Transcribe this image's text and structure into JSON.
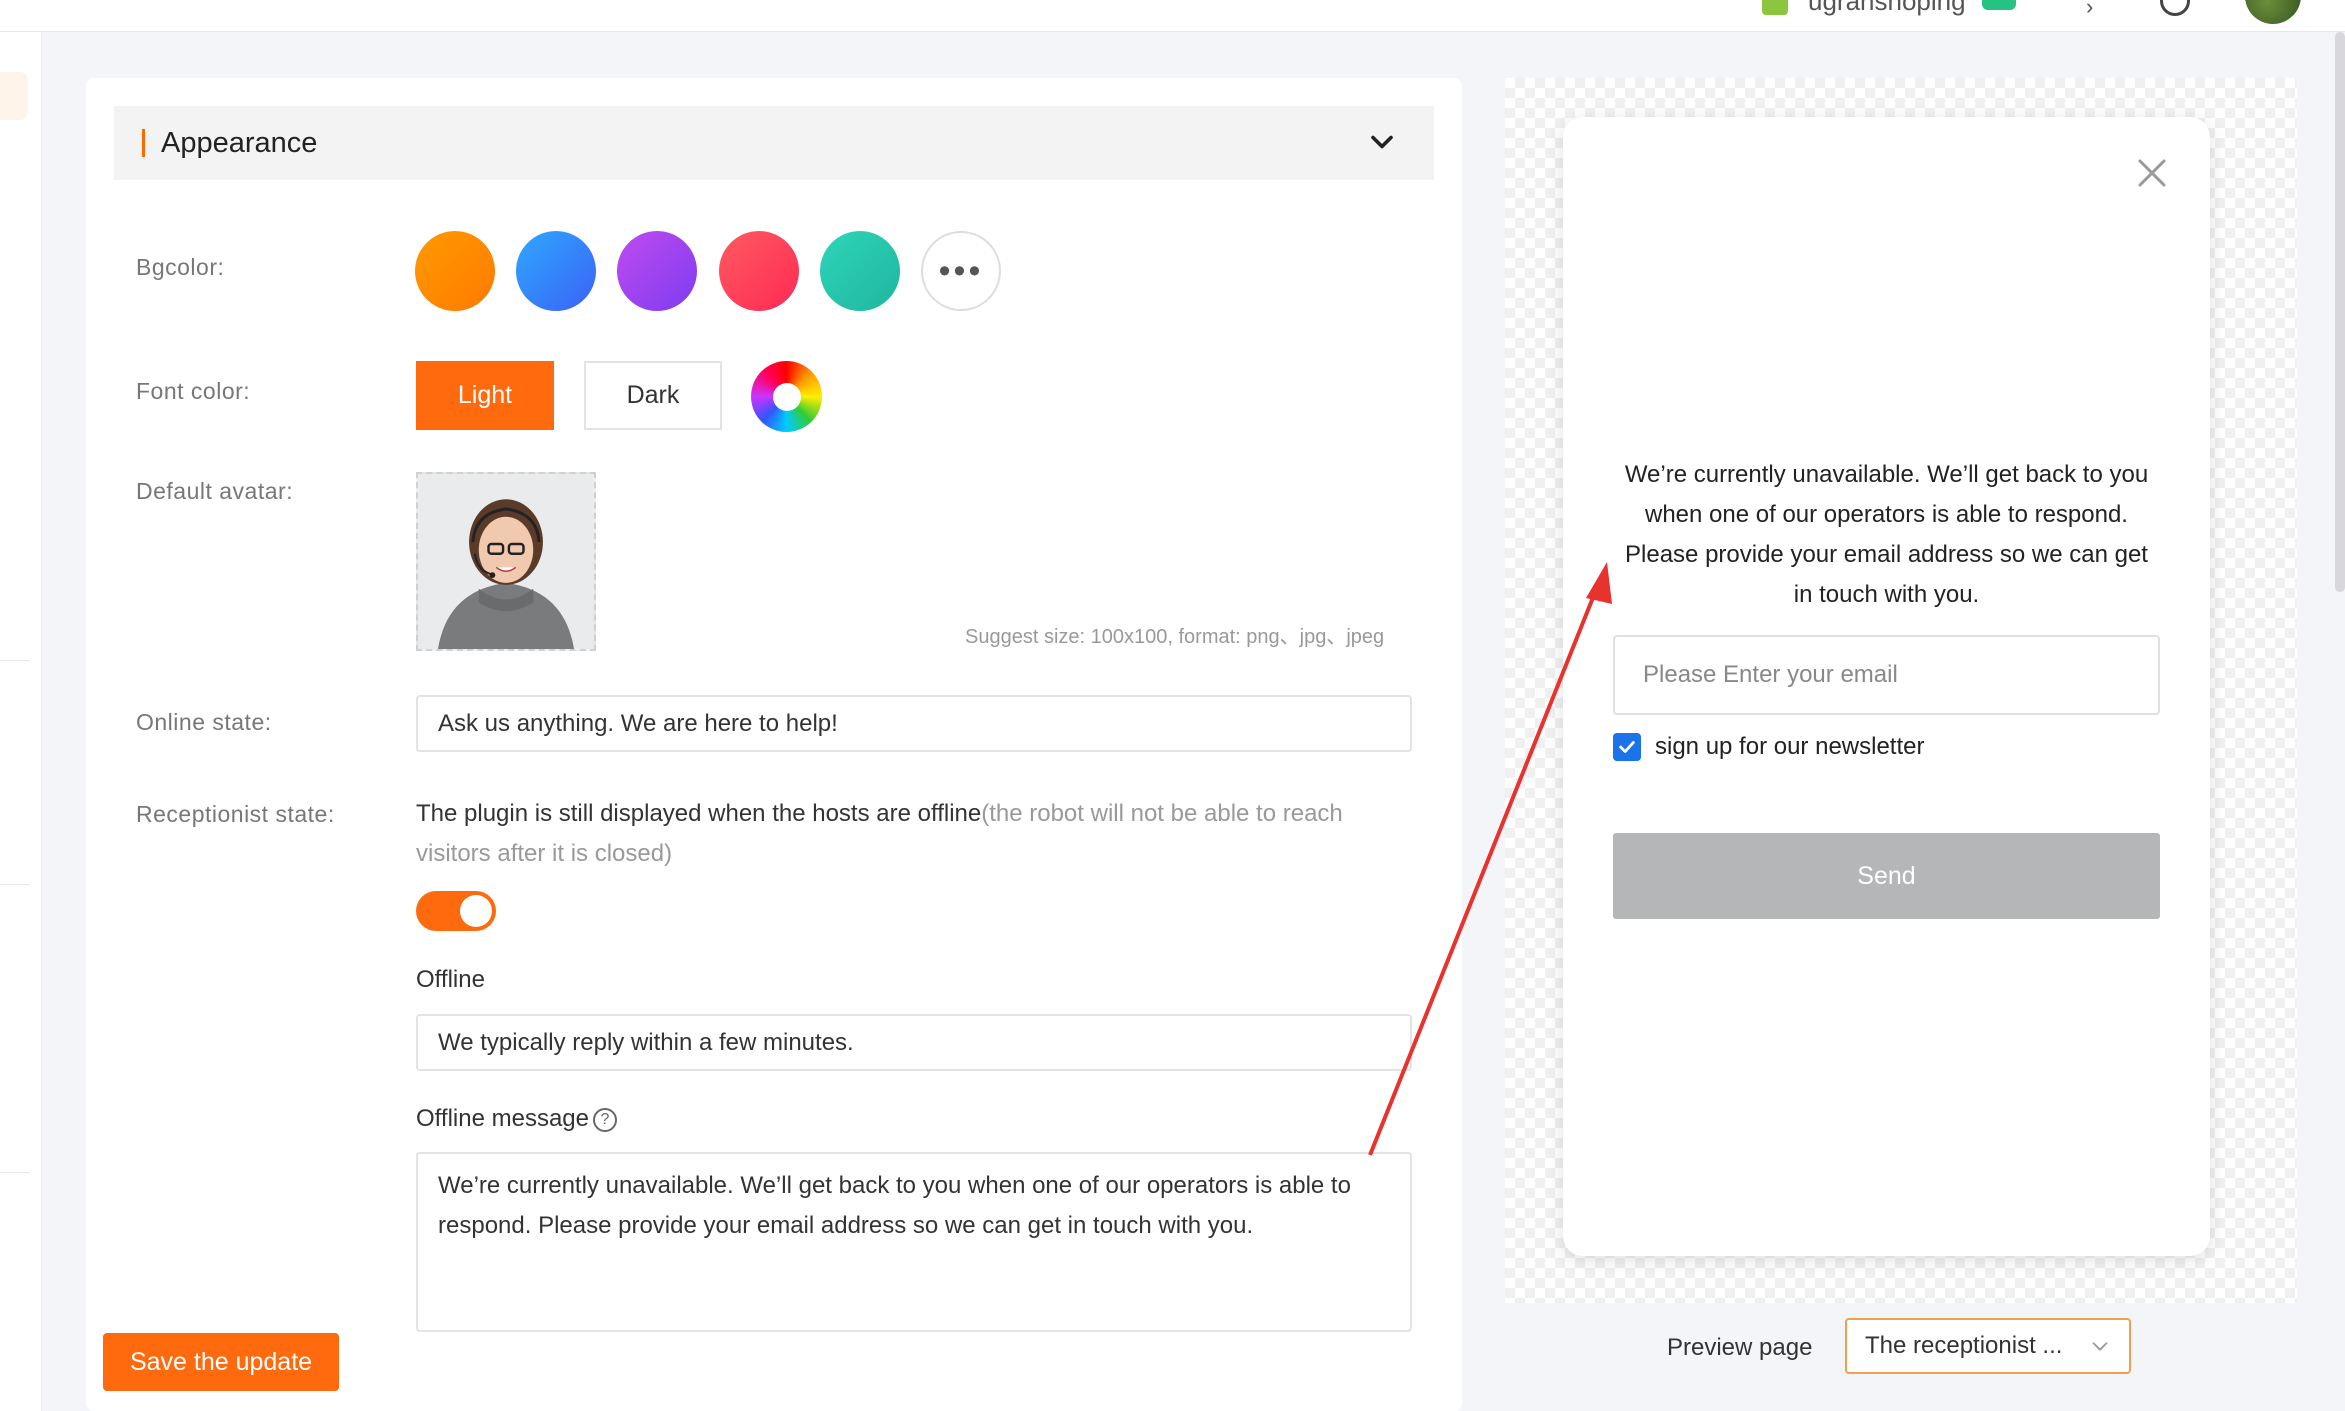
{
  "topbar": {
    "store_name": "ugrahshoping",
    "icons": [
      "store-icon",
      "chat-icon",
      "caret-icon",
      "info-icon",
      "user-avatar"
    ]
  },
  "section": {
    "title": "Appearance"
  },
  "labels": {
    "bgcolor": "Bgcolor:",
    "font_color": "Font color:",
    "default_avatar": "Default avatar:",
    "online_state": "Online state:",
    "receptionist_state": "Receptionist state:"
  },
  "bgcolor": {
    "swatches": [
      "#FF8A00",
      "#3B7BF6",
      "#9D45F0",
      "#FF3F5A",
      "#24C7AE"
    ],
    "more_label": "•••"
  },
  "font_color": {
    "light": "Light",
    "dark": "Dark",
    "selected": "Light"
  },
  "avatar": {
    "suggest": "Suggest size: 100x100, format: png、jpg、jpeg"
  },
  "online_state": {
    "value": "Ask us anything. We are here to help!"
  },
  "receptionist": {
    "text_main": "The plugin is still displayed when the hosts are offline",
    "text_note": "(the robot will not be able to reach visitors after it is closed)",
    "toggle_on": true
  },
  "offline": {
    "label": "Offline",
    "value": "We typically reply within a few minutes."
  },
  "offline_message": {
    "label": "Offline message",
    "help": "?",
    "value": "We’re currently unavailable. We’ll get back to you when one of our operators is able to respond. Please provide your email address so we can get in touch with you."
  },
  "save_button": "Save the update",
  "preview": {
    "message": "We’re currently unavailable. We’ll get back to you when one of our operators is able to respond. Please provide your email address so we can get in touch with you.",
    "email_placeholder": "Please Enter your email",
    "newsletter": "sign up for our newsletter",
    "newsletter_checked": true,
    "send": "Send",
    "page_label": "Preview page",
    "page_select": "The receptionist ...",
    "close_icon": "close-icon"
  },
  "colors": {
    "accent": "#FF6A0F",
    "checkbox": "#1A73E8",
    "send_disabled": "#B5B6B8",
    "annotation_arrow": "#E8322E"
  }
}
